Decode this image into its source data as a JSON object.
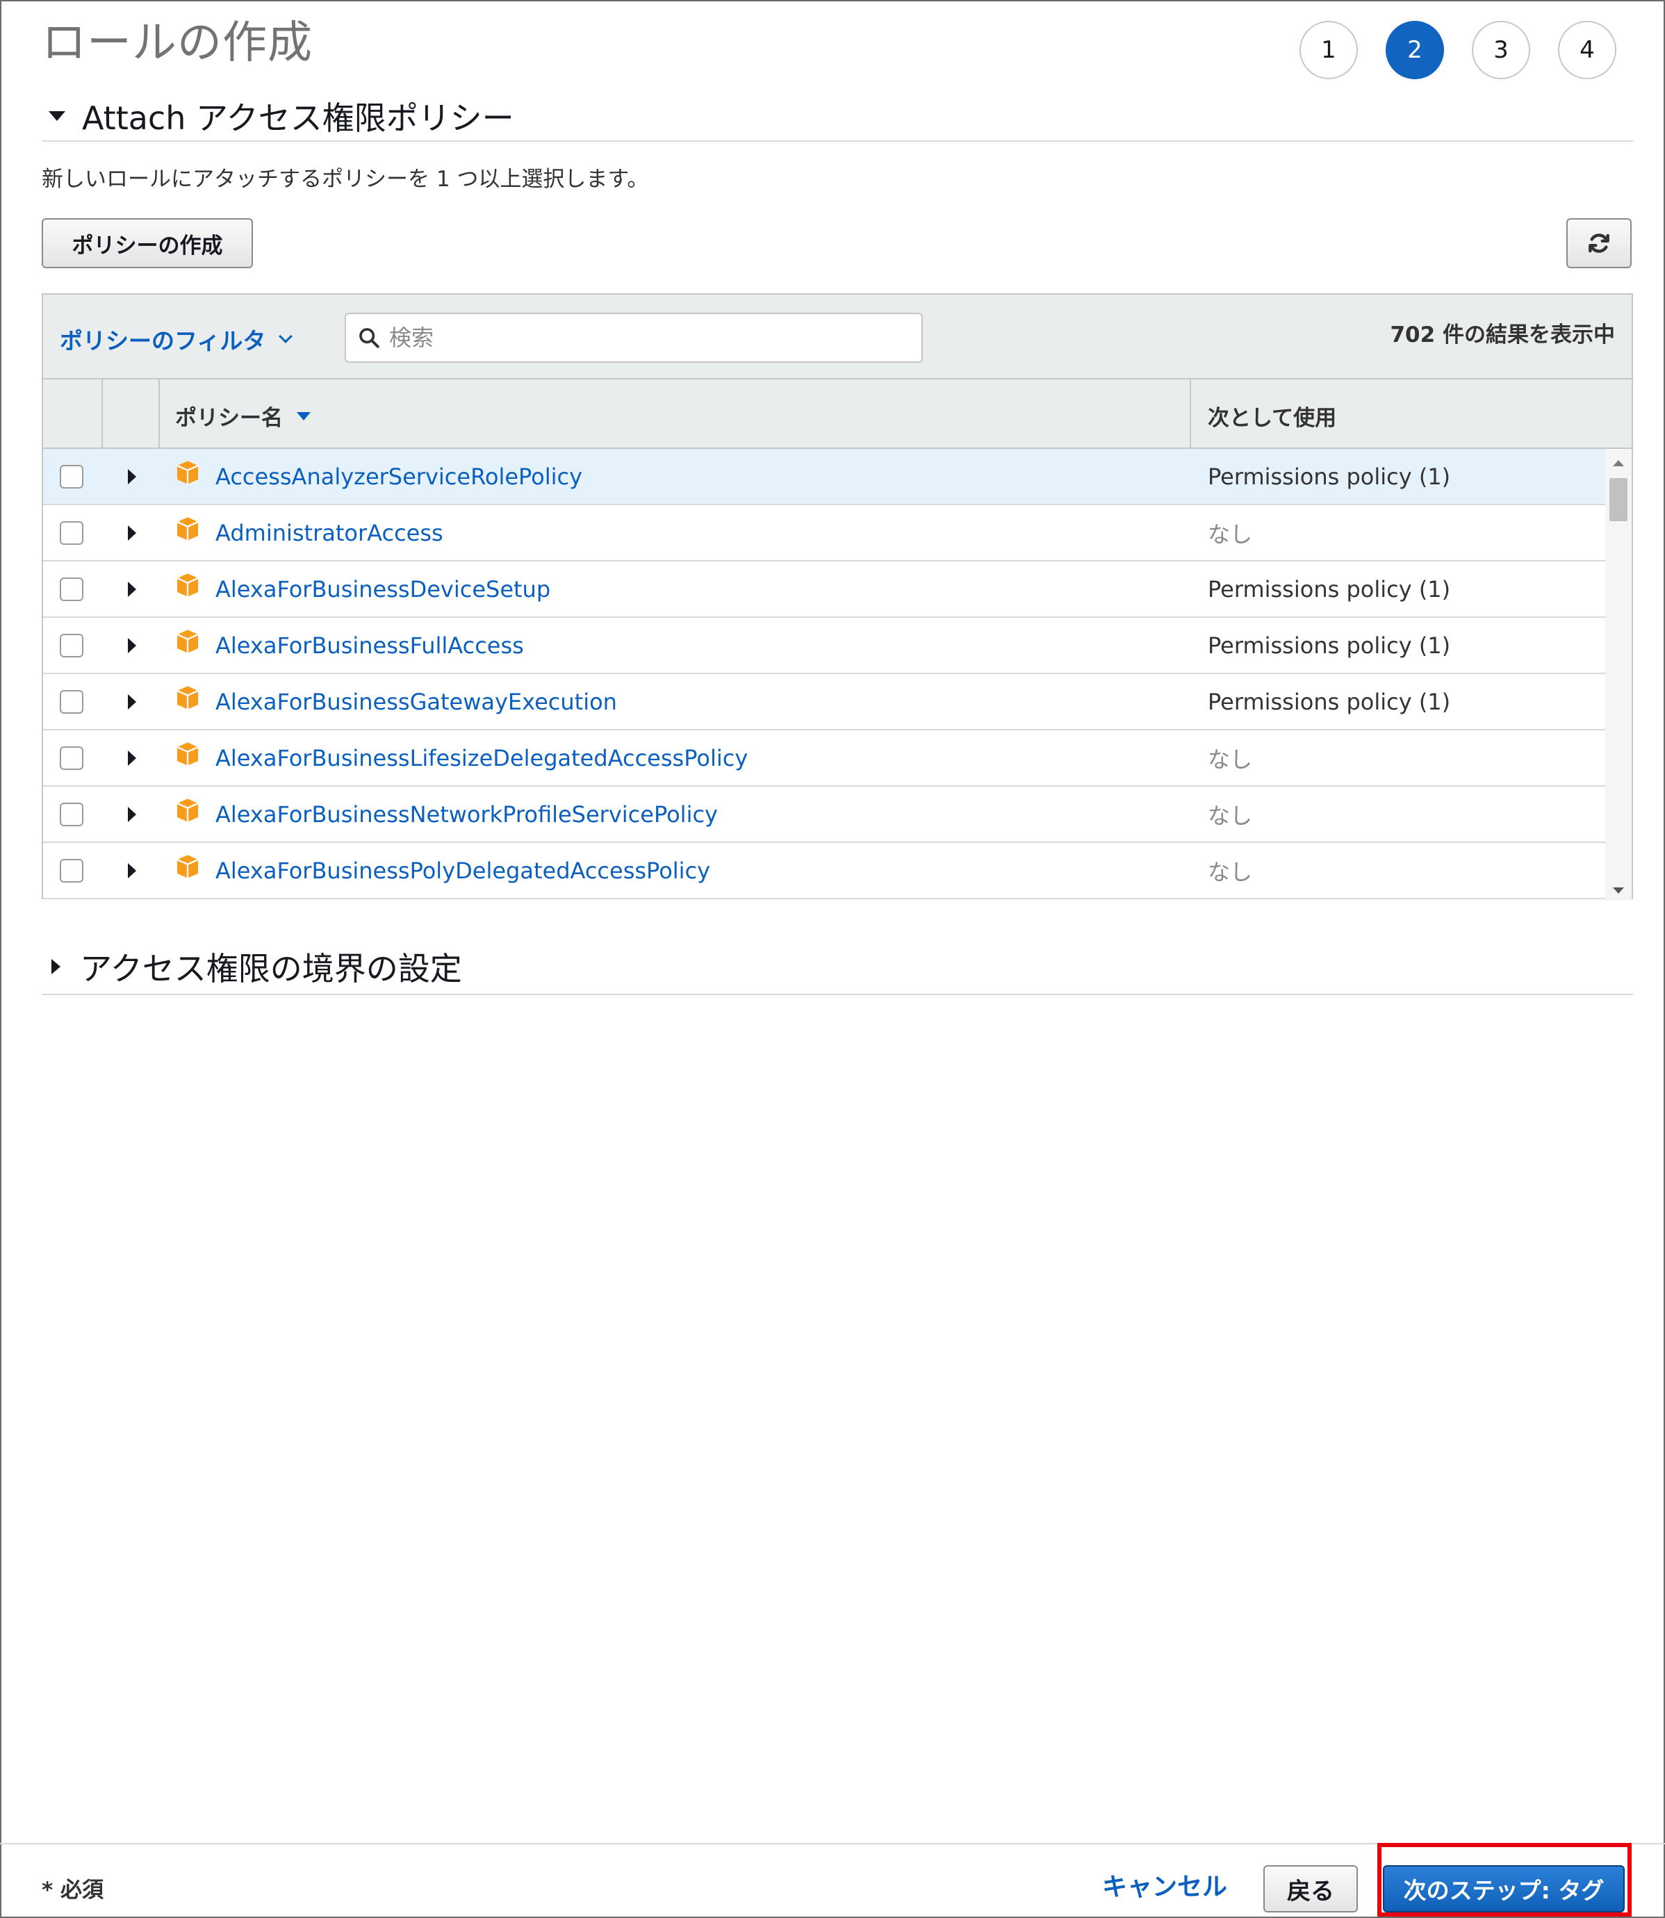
{
  "page": {
    "title": "ロールの作成"
  },
  "steps": [
    {
      "label": "1",
      "active": false
    },
    {
      "label": "2",
      "active": true
    },
    {
      "label": "3",
      "active": false
    },
    {
      "label": "4",
      "active": false
    }
  ],
  "attach_section": {
    "title": "Attach アクセス権限ポリシー",
    "description": "新しいロールにアタッチするポリシーを 1 つ以上選択します。",
    "create_policy_label": "ポリシーの作成",
    "refresh_icon": "refresh-icon"
  },
  "toolbar": {
    "filter_label": "ポリシーのフィルタ",
    "search_placeholder": "検索",
    "result_count": "702 件の結果を表示中"
  },
  "table": {
    "columns": {
      "name": "ポリシー名",
      "used_as": "次として使用"
    },
    "rows": [
      {
        "name": "AccessAnalyzerServiceRolePolicy",
        "used_as": "Permissions policy (1)",
        "selected": true
      },
      {
        "name": "AdministratorAccess",
        "used_as": "なし"
      },
      {
        "name": "AlexaForBusinessDeviceSetup",
        "used_as": "Permissions policy (1)"
      },
      {
        "name": "AlexaForBusinessFullAccess",
        "used_as": "Permissions policy (1)"
      },
      {
        "name": "AlexaForBusinessGatewayExecution",
        "used_as": "Permissions policy (1)"
      },
      {
        "name": "AlexaForBusinessLifesizeDelegatedAccessPolicy",
        "used_as": "なし"
      },
      {
        "name": "AlexaForBusinessNetworkProfileServicePolicy",
        "used_as": "なし"
      },
      {
        "name": "AlexaForBusinessPolyDelegatedAccessPolicy",
        "used_as": "なし"
      }
    ]
  },
  "boundary_section": {
    "title": "アクセス権限の境界の設定"
  },
  "footer": {
    "required_note": "* 必須",
    "cancel_label": "キャンセル",
    "back_label": "戻る",
    "next_label": "次のステップ: タグ"
  },
  "colors": {
    "accent": "#1165c1",
    "link": "#0a5fbf",
    "policy_icon": "#f89c1b",
    "highlight": "#e8000f"
  }
}
